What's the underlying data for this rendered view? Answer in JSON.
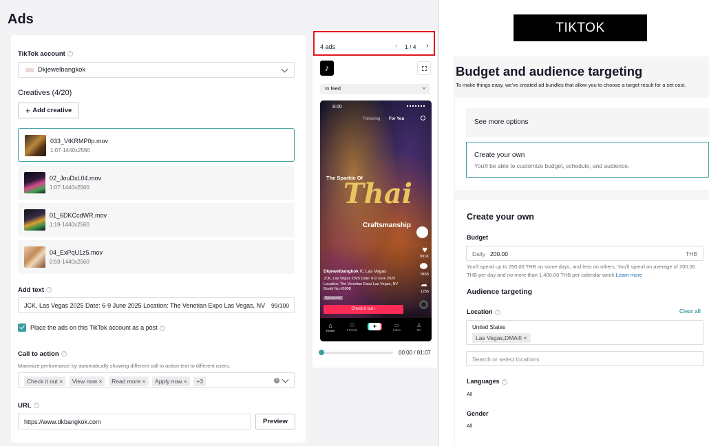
{
  "left": {
    "title": "Ads",
    "account": {
      "label": "TikTok account",
      "value": "Dkjewelbangkok"
    },
    "creatives": {
      "label": "Creatives (4/20)",
      "add_button": "Add creative",
      "items": [
        {
          "name": "033_VtKRMP0p.mov",
          "meta": "1:07·1440x2560"
        },
        {
          "name": "02_JouDxL04.mov",
          "meta": "1:07·1440x2560"
        },
        {
          "name": "01_6DKCcdWR.mov",
          "meta": "1:19·1440x2560"
        },
        {
          "name": "04_ExPqU1z5.mov",
          "meta": "0:59·1440x2560"
        }
      ]
    },
    "add_text": {
      "label": "Add text",
      "value": "JCK, Las Vegas 2025 Date: 6-9 June 2025 Location: The Venetian Expo Las Vegas, NV",
      "count": "99/100"
    },
    "post_checkbox": {
      "label": "Place the ads on this TikTok account as a post",
      "checked": true
    },
    "cta": {
      "label": "Call to action",
      "description": "Maximize performance by automatically showing different call to action text to different users.",
      "chips": [
        "Check it out",
        "View now",
        "Read more",
        "Apply now"
      ],
      "more": "+3"
    },
    "url": {
      "label": "URL",
      "value": "https://www.dkbangkok.com",
      "preview_button": "Preview"
    }
  },
  "preview": {
    "count": "4 ads",
    "pager": "1 / 4",
    "placement": "In feed",
    "phone": {
      "time": "8:00",
      "tab_following": "Following",
      "tab_foryou": "For You",
      "headline_small": "The Sparkle Of",
      "headline_big": "Thai",
      "headline_sub": "Craftsmanship",
      "username": "Dkjewelbangkok",
      "caption_overlay": "K, Las Vegas",
      "caption": "JCK, Las Vegas 2025 Date: 6-9 June 2025 Location: The Venetian Expo Las Vegas, NV Booth No.#5008",
      "sponsored": "Sponsored",
      "cta_button": "Check it out",
      "likes": "991K",
      "comments": "3456",
      "shares": "1256",
      "nav": [
        "Home",
        "Friends",
        "",
        "Inbox",
        "Me"
      ]
    },
    "time": "00:00 / 01:07",
    "progress": 0.02
  },
  "right": {
    "banner": "TIKTOK",
    "title": "Budget and audience targeting",
    "subtitle": "To make things easy, we've created ad bundles that allow you to choose a target result for a set cost.",
    "see_more": "See more options",
    "create_own_option": {
      "title": "Create your own",
      "desc": "You'll be able to customize budget, schedule, and audience."
    },
    "section_title": "Create your own",
    "budget": {
      "label": "Budget",
      "mode": "Daily",
      "amount": "200.00",
      "currency": "THB",
      "note": "You'll spend up to 250.00 THB on some days, and less on others. You'll spend an average of 200.00 THB per day and no more than 1,400.00 THB per calendar week.",
      "learn_more": "Learn more"
    },
    "audience_title": "Audience targeting",
    "location": {
      "label": "Location",
      "clear": "Clear all",
      "country": "United States",
      "tag": "Las Vegas,DMA®",
      "placeholder": "Search or select locations"
    },
    "languages": {
      "label": "Languages",
      "value": "All"
    },
    "gender": {
      "label": "Gender",
      "value": "All"
    }
  },
  "colors": {
    "accent": "#3c9e9e",
    "tiktok_red": "#fe2c55",
    "highlight": "#e0161d",
    "link": "#1a6fbf"
  }
}
